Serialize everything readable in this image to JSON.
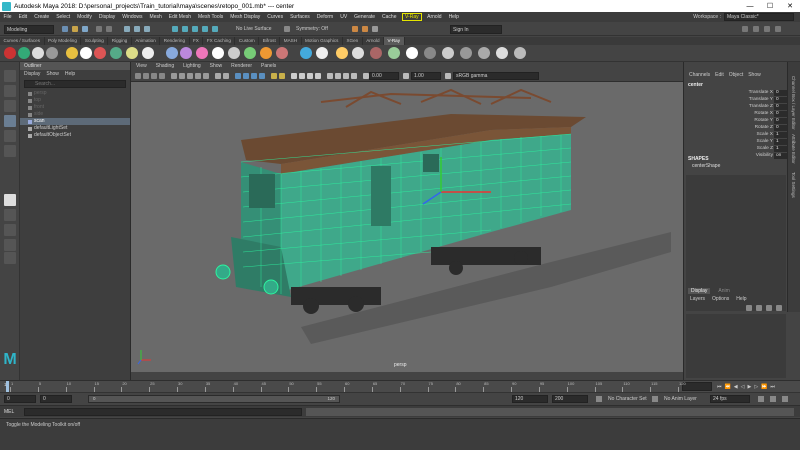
{
  "window": {
    "title": "Autodesk Maya 2018: D:\\personal_projects\\Train_tutorial\\maya\\scenes\\retopo_001.mb* --- center",
    "minimize": "—",
    "maximize": "☐",
    "close": "✕"
  },
  "menu": {
    "items": [
      "File",
      "Edit",
      "Create",
      "Select",
      "Modify",
      "Display",
      "Windows",
      "Mesh",
      "Edit Mesh",
      "Mesh Tools",
      "Mesh Display",
      "Curves",
      "Surfaces",
      "Deform",
      "UV",
      "Generate",
      "Cache"
    ],
    "vray": "V-Ray",
    "after": [
      "Arnold",
      "Help"
    ],
    "workspace_label": "Workspace :",
    "workspace_value": "Maya Classic*"
  },
  "status_line": {
    "mode": "Modeling",
    "live_surface": "No Live Surface",
    "symmetry": "Symmetry: Off",
    "sign_in": "Sign In"
  },
  "shelf_tabs": [
    "Curves / Surfaces",
    "Poly Modeling",
    "Sculpting",
    "Rigging",
    "Animation",
    "Rendering",
    "FX",
    "FX Caching",
    "Custom",
    "Bifrost",
    "MASH",
    "Motion Graphics",
    "XGen",
    "Arnold",
    "V-Ray"
  ],
  "shelf_active": "V-Ray",
  "outliner": {
    "title": "Outliner",
    "menu": [
      "Display",
      "Show",
      "Help"
    ],
    "search": "Search...",
    "rows": [
      {
        "label": "persp",
        "state": "dim"
      },
      {
        "label": "top",
        "state": "dim"
      },
      {
        "label": "front",
        "state": "dim"
      },
      {
        "label": "side",
        "state": "dim"
      },
      {
        "label": "scan",
        "state": "sel"
      },
      {
        "label": "defaultLightSet",
        "state": "normal"
      },
      {
        "label": "defaultObjectSet",
        "state": "normal"
      }
    ]
  },
  "viewport": {
    "menu": [
      "View",
      "Shading",
      "Lighting",
      "Show",
      "Renderer",
      "Panels"
    ],
    "field_value": "0.00",
    "field_value2": "1.00",
    "color_space": "sRGB gamma",
    "camera_label": "persp"
  },
  "channel_box": {
    "menu": [
      "Channels",
      "Edit",
      "Object",
      "Show"
    ],
    "object": "center",
    "attributes": [
      {
        "name": "Translate X",
        "value": "0"
      },
      {
        "name": "Translate Y",
        "value": "0"
      },
      {
        "name": "Translate Z",
        "value": "0"
      },
      {
        "name": "Rotate X",
        "value": "0"
      },
      {
        "name": "Rotate Y",
        "value": "0"
      },
      {
        "name": "Rotate Z",
        "value": "0"
      },
      {
        "name": "Scale X",
        "value": "1"
      },
      {
        "name": "Scale Y",
        "value": "1"
      },
      {
        "name": "Scale Z",
        "value": "1"
      },
      {
        "name": "Visibility",
        "value": "on"
      }
    ],
    "shapes_header": "SHAPES",
    "shape_name": "centerShape"
  },
  "layer_editor": {
    "tabs": [
      "Display",
      "Anim"
    ],
    "menu": [
      "Layers",
      "Options",
      "Help"
    ]
  },
  "side_tabs": [
    "Channel Box / Layer Editor",
    "Attribute Editor",
    "Tool Settings"
  ],
  "timeline": {
    "ticks": [
      "1",
      "5",
      "10",
      "15",
      "20",
      "25",
      "30",
      "35",
      "40",
      "45",
      "50",
      "55",
      "60",
      "65",
      "70",
      "75",
      "80",
      "85",
      "90",
      "95",
      "100",
      "105",
      "110",
      "115",
      "120"
    ],
    "current_frame": "1"
  },
  "range": {
    "start": "0",
    "anim_start": "0",
    "slider_start": "0",
    "slider_end": "120",
    "end": "120",
    "anim_end": "200",
    "character_set": "No Character Set",
    "anim_layer": "No Anim Layer",
    "fps": "24 fps"
  },
  "command_line": {
    "language": "MEL"
  },
  "help_line": "Toggle the Modeling Toolkit on/off"
}
